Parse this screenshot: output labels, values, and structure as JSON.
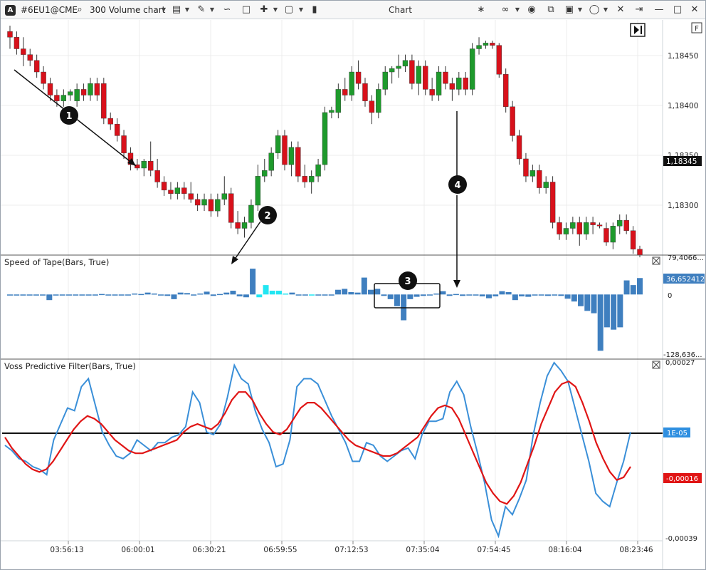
{
  "toolbar": {
    "logo_icon": "atas-logo-icon",
    "symbol": "#6EU1@CME",
    "chart_type": "300 Volume chart",
    "title": "Chart",
    "icons_left": [
      "search-icon",
      "chart-type-caret",
      "template-icon",
      "draw-icon",
      "indicators-icon",
      "bookmark-icon",
      "crosshair-icon",
      "window-icon",
      "box-icon"
    ],
    "icons_right": [
      "collapse-icon",
      "link-icon",
      "camera-icon",
      "copy-icon",
      "lock-icon",
      "circle-icon",
      "tools-icon",
      "pin-icon",
      "minimize-icon",
      "maximize-icon",
      "close-icon"
    ]
  },
  "price_axis": {
    "ticks": [
      "1,18450",
      "1,18400",
      "1,18350",
      "1,18300"
    ],
    "current_price": "1,18345",
    "top_left_label": "F"
  },
  "tape_panel": {
    "title": "Speed of Tape(Bars, True)",
    "top_label": "79,4066...",
    "zero_label": "0",
    "bottom_label": "-128,636...",
    "current_value": "36,652412"
  },
  "voss_panel": {
    "title": "Voss Predictive Filter(Bars, True)",
    "top_label": "0,00027",
    "bottom_label": "-0,00039",
    "blue_value": "1E-05",
    "red_value": "-0,00016"
  },
  "time_axis": [
    "03:56:13",
    "06:00:01",
    "06:30:21",
    "06:59:55",
    "07:12:53",
    "07:35:04",
    "07:54:45",
    "08:16:04",
    "08:23:46"
  ],
  "annotations": [
    "1",
    "2",
    "3",
    "4"
  ],
  "colors": {
    "up": "#1e9a2c",
    "down": "#d8111b",
    "tape": "#3f7fbf",
    "tape_cyan": "#22e6f2",
    "voss_blue": "#3a8fd8",
    "voss_red": "#e01515",
    "current_price_bg": "#111111",
    "blue_badge": "#2f8fe0",
    "red_badge": "#e01515"
  },
  "chart_data": [
    {
      "type": "candlestick",
      "title": "#6EU1@CME",
      "ylim": [
        1.1828,
        1.18475
      ],
      "candles": [
        [
          1.1847,
          1.18475,
          1.18455,
          1.18465
        ],
        [
          1.18465,
          1.1847,
          1.1845,
          1.18455
        ],
        [
          1.18455,
          1.18465,
          1.1844,
          1.1845
        ],
        [
          1.1845,
          1.18455,
          1.1844,
          1.18445
        ],
        [
          1.18445,
          1.1845,
          1.1843,
          1.18435
        ],
        [
          1.18435,
          1.1844,
          1.1842,
          1.18425
        ],
        [
          1.18425,
          1.1843,
          1.1841,
          1.18415
        ],
        [
          1.18415,
          1.1842,
          1.18405,
          1.1841
        ],
        [
          1.1841,
          1.1842,
          1.18405,
          1.18415
        ],
        [
          1.18415,
          1.1842,
          1.1841,
          1.18418
        ],
        [
          1.1841,
          1.18425,
          1.18405,
          1.1842
        ],
        [
          1.1842,
          1.18425,
          1.1841,
          1.18415
        ],
        [
          1.18415,
          1.1843,
          1.1841,
          1.18425
        ],
        [
          1.18425,
          1.1843,
          1.1841,
          1.18415
        ],
        [
          1.18425,
          1.1843,
          1.1839,
          1.18395
        ],
        [
          1.18395,
          1.184,
          1.18385,
          1.1839
        ],
        [
          1.1839,
          1.18395,
          1.18375,
          1.1838
        ],
        [
          1.1838,
          1.18385,
          1.1836,
          1.18365
        ],
        [
          1.18365,
          1.1837,
          1.1835,
          1.18355
        ],
        [
          1.18355,
          1.1836,
          1.1835,
          1.18352
        ],
        [
          1.18352,
          1.1836,
          1.18345,
          1.18358
        ],
        [
          1.18358,
          1.18375,
          1.18345,
          1.1835
        ],
        [
          1.1835,
          1.1836,
          1.18335,
          1.1834
        ],
        [
          1.1834,
          1.18345,
          1.18328,
          1.18333
        ],
        [
          1.18333,
          1.1834,
          1.18325,
          1.1833
        ],
        [
          1.1833,
          1.1834,
          1.18325,
          1.18335
        ],
        [
          1.18335,
          1.1834,
          1.18325,
          1.1833
        ],
        [
          1.1833,
          1.1834,
          1.18322,
          1.18325
        ],
        [
          1.18325,
          1.1833,
          1.18315,
          1.1832
        ],
        [
          1.1832,
          1.1833,
          1.18315,
          1.18325
        ],
        [
          1.18325,
          1.1833,
          1.1831,
          1.18315
        ],
        [
          1.18315,
          1.1833,
          1.1831,
          1.18325
        ],
        [
          1.18325,
          1.18345,
          1.1832,
          1.1833
        ],
        [
          1.1833,
          1.18335,
          1.183,
          1.18305
        ],
        [
          1.18305,
          1.18315,
          1.18295,
          1.183
        ],
        [
          1.183,
          1.1831,
          1.18292,
          1.18305
        ],
        [
          1.18305,
          1.18325,
          1.183,
          1.1832
        ],
        [
          1.1832,
          1.18355,
          1.18315,
          1.18345
        ],
        [
          1.18345,
          1.1836,
          1.1834,
          1.1835
        ],
        [
          1.1835,
          1.1837,
          1.18345,
          1.18365
        ],
        [
          1.18365,
          1.18385,
          1.1836,
          1.1838
        ],
        [
          1.1838,
          1.18385,
          1.1835,
          1.18355
        ],
        [
          1.18355,
          1.18375,
          1.18345,
          1.1837
        ],
        [
          1.1837,
          1.18375,
          1.1834,
          1.18345
        ],
        [
          1.18345,
          1.18355,
          1.18335,
          1.1834
        ],
        [
          1.1834,
          1.1835,
          1.1833,
          1.18345
        ],
        [
          1.18345,
          1.1836,
          1.1834,
          1.18355
        ],
        [
          1.18355,
          1.18405,
          1.1835,
          1.184
        ],
        [
          1.184,
          1.18405,
          1.18395,
          1.18402
        ],
        [
          1.184,
          1.18425,
          1.18395,
          1.1842
        ],
        [
          1.1842,
          1.1843,
          1.1841,
          1.18415
        ],
        [
          1.18415,
          1.1844,
          1.1841,
          1.18435
        ],
        [
          1.18435,
          1.18445,
          1.1842,
          1.18425
        ],
        [
          1.18425,
          1.1843,
          1.18405,
          1.1841
        ],
        [
          1.1841,
          1.18415,
          1.1839,
          1.184
        ],
        [
          1.184,
          1.18425,
          1.18395,
          1.1842
        ],
        [
          1.1842,
          1.1844,
          1.18415,
          1.18435
        ],
        [
          1.18435,
          1.1844,
          1.18425,
          1.18438
        ],
        [
          1.18438,
          1.1845,
          1.1843,
          1.1844
        ],
        [
          1.1844,
          1.1845,
          1.18435,
          1.18445
        ],
        [
          1.18445,
          1.1845,
          1.1842,
          1.18425
        ],
        [
          1.18425,
          1.18445,
          1.18415,
          1.1844
        ],
        [
          1.1844,
          1.18445,
          1.18415,
          1.1842
        ],
        [
          1.1842,
          1.1843,
          1.1841,
          1.18415
        ],
        [
          1.18415,
          1.1844,
          1.1841,
          1.18435
        ],
        [
          1.18435,
          1.1844,
          1.1842,
          1.18425
        ],
        [
          1.18425,
          1.1843,
          1.1841,
          1.1842
        ],
        [
          1.1842,
          1.18435,
          1.18415,
          1.1843
        ],
        [
          1.1843,
          1.18435,
          1.18415,
          1.1842
        ],
        [
          1.1842,
          1.1846,
          1.18415,
          1.18455
        ],
        [
          1.18455,
          1.18465,
          1.1845,
          1.18458
        ],
        [
          1.18458,
          1.18462,
          1.18455,
          1.1846
        ],
        [
          1.1846,
          1.18462,
          1.18455,
          1.18458
        ],
        [
          1.18458,
          1.1846,
          1.1843,
          1.18433
        ],
        [
          1.18433,
          1.18438,
          1.184,
          1.18405
        ],
        [
          1.18405,
          1.1841,
          1.18375,
          1.1838
        ],
        [
          1.1838,
          1.18385,
          1.18355,
          1.1836
        ],
        [
          1.1836,
          1.18365,
          1.1834,
          1.18345
        ],
        [
          1.18345,
          1.18355,
          1.1834,
          1.1835
        ],
        [
          1.1835,
          1.18355,
          1.1833,
          1.18335
        ],
        [
          1.18335,
          1.18345,
          1.1833,
          1.1834
        ],
        [
          1.1834,
          1.18345,
          1.183,
          1.18305
        ],
        [
          1.18305,
          1.1831,
          1.1829,
          1.18295
        ],
        [
          1.18295,
          1.18305,
          1.1829,
          1.183
        ],
        [
          1.183,
          1.1831,
          1.18295,
          1.18305
        ],
        [
          1.18305,
          1.1831,
          1.18285,
          1.18295
        ],
        [
          1.18295,
          1.1831,
          1.1829,
          1.18305
        ],
        [
          1.18305,
          1.1831,
          1.18295,
          1.18303
        ],
        [
          1.18303,
          1.18305,
          1.183,
          1.18302
        ],
        [
          1.183,
          1.18305,
          1.18285,
          1.18288
        ],
        [
          1.18288,
          1.18305,
          1.18282,
          1.18302
        ],
        [
          1.18302,
          1.18312,
          1.18295,
          1.18307
        ],
        [
          1.18307,
          1.18312,
          1.18295,
          1.18298
        ],
        [
          1.18298,
          1.18302,
          1.18278,
          1.18282
        ],
        [
          1.18282,
          1.18285,
          1.18275,
          1.18277
        ]
      ]
    },
    {
      "type": "bar",
      "title": "Speed of Tape(Bars, True)",
      "ylim": [
        -128.636,
        79.4066
      ],
      "values": [
        0,
        0,
        0,
        0,
        0,
        -2,
        -12,
        0,
        0,
        0,
        0,
        0,
        0,
        0,
        1,
        0,
        -1,
        0,
        0,
        2,
        1,
        4,
        2,
        -1,
        -3,
        -10,
        4,
        3,
        -2,
        2,
        6,
        -3,
        1,
        4,
        8,
        -4,
        -6,
        55,
        -6,
        20,
        8,
        8,
        2,
        4,
        0,
        0,
        0,
        -2,
        0,
        0,
        10,
        12,
        5,
        4,
        36,
        10,
        12,
        -3,
        -10,
        -25,
        -55,
        -10,
        -5,
        -3,
        -1,
        2,
        7,
        -3,
        1,
        -3,
        -2,
        -1,
        -4,
        -8,
        -4,
        7,
        5,
        -12,
        -4,
        -5,
        -1,
        -1,
        -3,
        -2,
        -3,
        -9,
        -15,
        -25,
        -35,
        -40,
        -120,
        -70,
        -75,
        -70,
        30,
        20,
        35
      ],
      "cyan_indices": [
        38,
        39,
        40,
        41,
        42,
        46
      ]
    },
    {
      "type": "line",
      "title": "Voss Predictive Filter(Bars, True)",
      "ylim": [
        -0.00039,
        0.00027
      ],
      "series": [
        {
          "color": "blue",
          "values": [
            -4e-05,
            -6e-05,
            -9e-05,
            -0.0001,
            -0.00012,
            -0.00013,
            -0.00015,
            -2e-05,
            4e-05,
            0.0001,
            9e-05,
            0.00018,
            0.00021,
            0.00011,
            1e-05,
            -4e-05,
            -8e-05,
            -9e-05,
            -7e-05,
            -2e-05,
            -4e-05,
            -6e-05,
            -3e-05,
            -3e-05,
            -1e-05,
            0.0,
            3e-05,
            0.00016,
            0.00012,
            1e-05,
            0.0,
            4e-05,
            0.00014,
            0.00026,
            0.00021,
            0.00019,
            9e-05,
            2e-05,
            -3e-05,
            -0.00012,
            -0.00011,
            -2e-05,
            0.00018,
            0.00021,
            0.00021,
            0.00019,
            0.00013,
            7e-05,
            2e-05,
            -3e-05,
            -0.0001,
            -0.0001,
            -3e-05,
            -4e-05,
            -8e-05,
            -0.0001,
            -8e-05,
            -6e-05,
            -5e-05,
            -9e-05,
            0.0,
            5e-05,
            5e-05,
            6e-05,
            0.00016,
            0.0002,
            0.00015,
            3e-05,
            -7e-05,
            -0.00018,
            -0.00032,
            -0.00038,
            -0.00027,
            -0.0003,
            -0.00024,
            -0.00017,
            0.0,
            0.00012,
            0.00022,
            0.00027,
            0.00024,
            0.0002,
            0.0001,
            0.0,
            -0.0001,
            -0.00022,
            -0.00025,
            -0.00027,
            -0.00018,
            -0.0001,
            1e-05
          ]
        },
        {
          "color": "red",
          "values": [
            -1e-05,
            -5e-05,
            -8e-05,
            -0.00011,
            -0.00013,
            -0.00014,
            -0.00013,
            -0.0001,
            -6e-05,
            -2e-05,
            2e-05,
            5e-05,
            7e-05,
            6e-05,
            4e-05,
            1e-05,
            -2e-05,
            -4e-05,
            -6e-05,
            -7e-05,
            -7e-05,
            -6e-05,
            -5e-05,
            -4e-05,
            -3e-05,
            -2e-05,
            1e-05,
            3e-05,
            4e-05,
            3e-05,
            2e-05,
            4e-05,
            8e-05,
            0.00013,
            0.00016,
            0.00016,
            0.00013,
            8e-05,
            4e-05,
            1e-05,
            0.0,
            2e-05,
            6e-05,
            0.0001,
            0.00012,
            0.00012,
            0.0001,
            7e-05,
            4e-05,
            1e-05,
            -2e-05,
            -4e-05,
            -5e-05,
            -6e-05,
            -7e-05,
            -8e-05,
            -8e-05,
            -7e-05,
            -5e-05,
            -3e-05,
            -1e-05,
            3e-05,
            7e-05,
            0.0001,
            0.00011,
            0.0001,
            6e-05,
            0.0,
            -6e-05,
            -0.00012,
            -0.00018,
            -0.00022,
            -0.00025,
            -0.00026,
            -0.00023,
            -0.00018,
            -0.00011,
            -4e-05,
            4e-05,
            0.0001,
            0.00016,
            0.00019,
            0.0002,
            0.00018,
            0.00012,
            5e-05,
            -3e-05,
            -9e-05,
            -0.00014,
            -0.00017,
            -0.00016,
            -0.00012
          ]
        }
      ]
    }
  ]
}
